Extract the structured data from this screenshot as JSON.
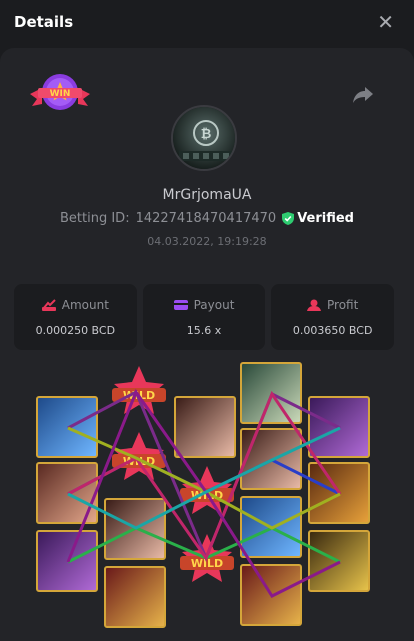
{
  "header": {
    "title": "Details"
  },
  "badge": {
    "text": "WIN"
  },
  "player": {
    "username": "MrGrjomaUA",
    "betting_id_label": "Betting ID:",
    "betting_id": "142274184704174 70",
    "verified": "Verified",
    "datetime": "04.03.2022, 19:19:28"
  },
  "stats": {
    "amount_label": "Amount",
    "amount_value": "0.000250 BCD",
    "payout_label": "Payout",
    "payout_value": "15.6 x",
    "profit_label": "Profit",
    "profit_value": "0.003650 BCD"
  },
  "wild_label": "WILD",
  "colors": {
    "accent_red": "#e8375a",
    "accent_purple": "#9b4cf2",
    "verified_green": "#2ecc71",
    "reel_border": "#d4a63a"
  }
}
